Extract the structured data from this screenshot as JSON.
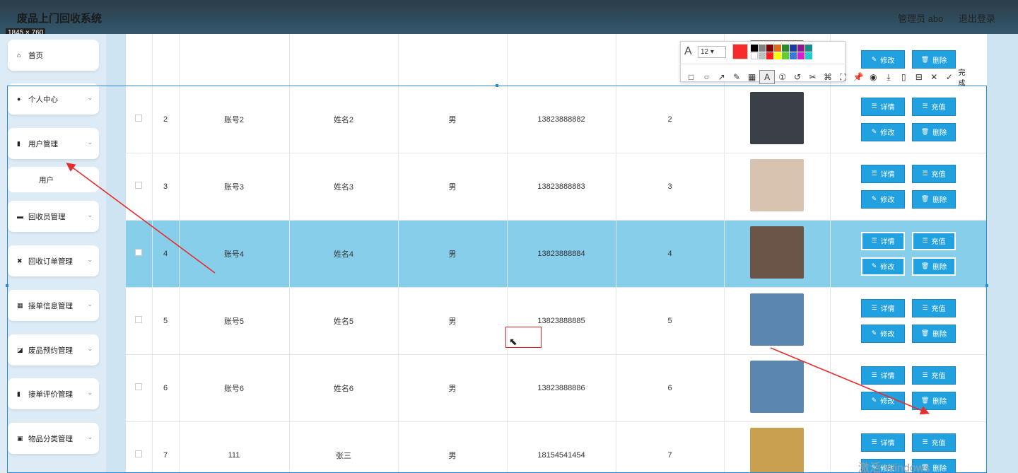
{
  "header": {
    "title": "废品上门回收系统",
    "dims_badge": "1845 × 760",
    "user_label": "管理员 abo",
    "logout_label": "退出登录"
  },
  "sidebar": {
    "items": [
      {
        "label": "首页",
        "icon": "home-icon",
        "expandable": false
      },
      {
        "label": "个人中心",
        "icon": "user-icon",
        "expandable": true
      },
      {
        "label": "用户管理",
        "icon": "clipboard-icon",
        "expandable": true
      },
      {
        "label": "回收员管理",
        "icon": "briefcase-icon",
        "expandable": true
      },
      {
        "label": "回收订单管理",
        "icon": "ticket-icon",
        "expandable": true
      },
      {
        "label": "接单信息管理",
        "icon": "grid-icon",
        "expandable": true
      },
      {
        "label": "废品预约管理",
        "icon": "chart-icon",
        "expandable": true
      },
      {
        "label": "接单评价管理",
        "icon": "bar-chart-icon",
        "expandable": true
      },
      {
        "label": "物品分类管理",
        "icon": "clipboard-check-icon",
        "expandable": true
      }
    ],
    "sub_item": "用户"
  },
  "table": {
    "rows": [
      {
        "index": "2",
        "account": "账号2",
        "name": "姓名2",
        "gender": "男",
        "phone": "13823888882",
        "value": "2",
        "highlight": false,
        "actions": [
          "详情",
          "充值",
          "修改",
          "删除"
        ],
        "avatar_color": "#3a3f48"
      },
      {
        "index": "3",
        "account": "账号3",
        "name": "姓名3",
        "gender": "男",
        "phone": "13823888883",
        "value": "3",
        "highlight": false,
        "actions": [
          "详情",
          "充值",
          "修改",
          "删除"
        ],
        "avatar_color": "#d8c2b0"
      },
      {
        "index": "4",
        "account": "账号4",
        "name": "姓名4",
        "gender": "男",
        "phone": "13823888884",
        "value": "4",
        "highlight": true,
        "actions": [
          "详情",
          "充值",
          "修改",
          "删除"
        ],
        "avatar_color": "#6b5448"
      },
      {
        "index": "5",
        "account": "账号5",
        "name": "姓名5",
        "gender": "男",
        "phone": "13823888885",
        "value": "5",
        "highlight": false,
        "actions": [
          "详情",
          "充值",
          "修改",
          "删除"
        ],
        "avatar_color": "#5a86b0"
      },
      {
        "index": "6",
        "account": "账号6",
        "name": "姓名6",
        "gender": "男",
        "phone": "13823888886",
        "value": "6",
        "highlight": false,
        "actions": [
          "详情",
          "充值",
          "修改",
          "删除"
        ],
        "avatar_color": "#5a86b0"
      },
      {
        "index": "7",
        "account": "111",
        "name": "张三",
        "gender": "男",
        "phone": "18154541454",
        "value": "7",
        "highlight": false,
        "actions": [
          "详情",
          "充值",
          "修改",
          "删除"
        ],
        "avatar_color": "#c8a050"
      }
    ],
    "top_partial_actions": [
      "修改",
      "删除"
    ]
  },
  "toolbar": {
    "font_size": "12",
    "current_color": "#f72b2b",
    "swatches": [
      "#000000",
      "#808080",
      "#800000",
      "#e06b1a",
      "#2a8a2a",
      "#1a3aa8",
      "#8a1a8a",
      "#1a8a8a",
      "#ffffff",
      "#c0c0c0",
      "#ff2020",
      "#ffff00",
      "#66cc33",
      "#3a7ad8",
      "#d020d0",
      "#22cccc"
    ],
    "done_label": "完成"
  },
  "watermark": "激活 Windows"
}
